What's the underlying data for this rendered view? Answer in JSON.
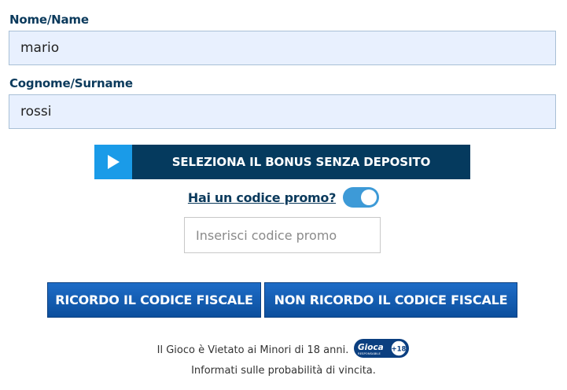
{
  "form": {
    "name": {
      "label": "Nome/Name",
      "value": "mario"
    },
    "surname": {
      "label": "Cognome/Surname",
      "value": "rossi"
    }
  },
  "bonus": {
    "label": "SELEZIONA IL BONUS SENZA DEPOSITO",
    "icon": "play-icon"
  },
  "promo": {
    "question": "Hai un codice promo?",
    "toggle_on": true,
    "placeholder": "Inserisci codice promo"
  },
  "buttons": {
    "remember_cf": "RICORDO IL CODICE FISCALE",
    "not_remember_cf": "NON RICORDO IL CODICE FISCALE"
  },
  "footer": {
    "line1": "Il Gioco è Vietato ai Minori di 18 anni.",
    "line2": "Informati sulle probabilità di vincita.",
    "badge_text": "Gioca",
    "badge_sub": "RESPONSABILE",
    "badge_age": "+18"
  },
  "colors": {
    "accent": "#053a5e",
    "play": "#1a9be8",
    "toggle": "#3d9ad7",
    "input_bg": "#e8f0fe",
    "button": "#0c4f9d"
  }
}
